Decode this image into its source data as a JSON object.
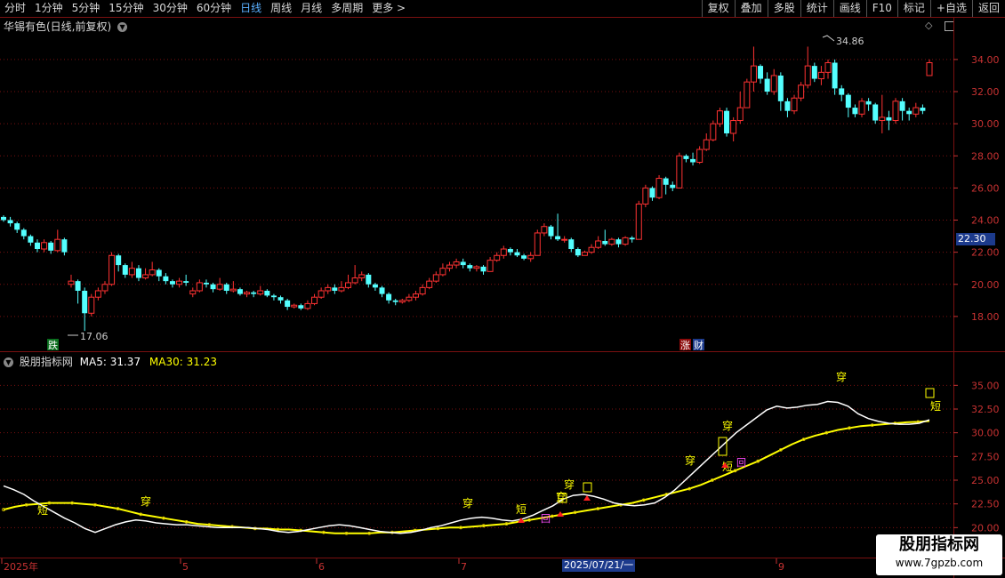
{
  "toolbar": {
    "left_items": [
      {
        "label": "分时",
        "active": false
      },
      {
        "label": "1分钟",
        "active": false
      },
      {
        "label": "5分钟",
        "active": false
      },
      {
        "label": "15分钟",
        "active": false
      },
      {
        "label": "30分钟",
        "active": false
      },
      {
        "label": "60分钟",
        "active": false
      },
      {
        "label": "日线",
        "active": true
      },
      {
        "label": "周线",
        "active": false
      },
      {
        "label": "月线",
        "active": false
      },
      {
        "label": "多周期",
        "active": false
      },
      {
        "label": "更多 >",
        "active": false
      }
    ],
    "right_items": [
      "复权",
      "叠加",
      "多股",
      "统计",
      "画线",
      "F10",
      "标记",
      "+自选",
      "返回"
    ]
  },
  "stock": {
    "title": "华锡有色(日线,前复权)",
    "current_price_tag": "22.30",
    "high_label": "34.86",
    "low_label": "17.06",
    "marker_die": "跌",
    "marker_zhang": "涨",
    "marker_cai": "财"
  },
  "indicator": {
    "name": "股朋指标网",
    "ma5_label": "MA5: 31.37",
    "ma30_label": "MA30: 31.23",
    "ma5_color": "#ffffff",
    "ma30_color": "#ffff00",
    "signal_chuan": "穿",
    "signal_duan": "短",
    "signal_hui": "回"
  },
  "axis": {
    "price_ticks": [
      "34.00",
      "32.00",
      "30.00",
      "28.00",
      "26.00",
      "24.00",
      "22.00",
      "20.00",
      "18.00"
    ],
    "indicator_ticks": [
      "35.00",
      "32.50",
      "30.00",
      "27.50",
      "25.00",
      "22.50",
      "20.00"
    ],
    "x_labels": [
      "2025年",
      "5",
      "6",
      "7",
      "9"
    ],
    "date_tag": "2025/07/21/一"
  },
  "colors": {
    "up": "#ff3232",
    "down": "#54ffff",
    "grid": "#7a1010",
    "axis_text": "#c83232"
  },
  "watermark": {
    "line1": "股朋指标网",
    "line2": "www.7gpzb.com"
  },
  "chart_data": {
    "type": "candlestick",
    "y_range": [
      16.0,
      35.6
    ],
    "candles": [
      [
        24.2,
        24.0,
        24.3,
        23.9
      ],
      [
        24.0,
        23.8,
        24.2,
        23.6
      ],
      [
        23.8,
        23.4,
        23.9,
        23.2
      ],
      [
        23.4,
        23.0,
        23.5,
        22.8
      ],
      [
        23.0,
        22.6,
        23.1,
        22.4
      ],
      [
        22.6,
        22.2,
        22.8,
        22.0
      ],
      [
        22.2,
        22.6,
        22.8,
        22.0
      ],
      [
        22.6,
        22.1,
        22.7,
        21.9
      ],
      [
        22.1,
        22.8,
        23.4,
        22.0
      ],
      [
        22.8,
        22.0,
        22.9,
        21.8
      ],
      [
        20.0,
        20.2,
        20.6,
        19.8
      ],
      [
        20.2,
        19.6,
        20.3,
        18.8
      ],
      [
        19.6,
        18.2,
        19.8,
        17.1
      ],
      [
        18.2,
        19.2,
        19.4,
        18.0
      ],
      [
        19.2,
        19.6,
        19.8,
        19.0
      ],
      [
        19.6,
        20.0,
        20.2,
        19.4
      ],
      [
        20.0,
        21.8,
        22.0,
        19.9
      ],
      [
        21.8,
        21.2,
        21.9,
        20.8
      ],
      [
        21.2,
        20.6,
        21.3,
        20.4
      ],
      [
        20.6,
        21.0,
        21.4,
        20.4
      ],
      [
        21.0,
        20.4,
        21.2,
        20.2
      ],
      [
        20.4,
        20.6,
        21.0,
        20.3
      ],
      [
        20.6,
        20.9,
        21.4,
        20.5
      ],
      [
        20.9,
        20.5,
        21.0,
        20.2
      ],
      [
        20.5,
        20.2,
        20.7,
        20.0
      ],
      [
        20.2,
        20.0,
        20.3,
        19.8
      ],
      [
        20.0,
        20.2,
        20.4,
        19.8
      ],
      [
        20.2,
        20.1,
        20.6,
        19.9
      ],
      [
        19.4,
        19.6,
        19.8,
        19.2
      ],
      [
        19.6,
        20.1,
        20.3,
        19.5
      ],
      [
        20.1,
        20.0,
        20.3,
        19.8
      ],
      [
        20.0,
        19.7,
        20.1,
        19.5
      ],
      [
        19.7,
        20.0,
        20.4,
        19.6
      ],
      [
        20.0,
        19.6,
        20.1,
        19.4
      ],
      [
        19.6,
        19.7,
        20.2,
        19.5
      ],
      [
        19.7,
        19.4,
        19.8,
        19.3
      ],
      [
        19.4,
        19.5,
        19.6,
        19.2
      ],
      [
        19.5,
        19.4,
        19.6,
        19.2
      ],
      [
        19.4,
        19.6,
        19.9,
        19.3
      ],
      [
        19.6,
        19.3,
        19.7,
        19.2
      ],
      [
        19.3,
        19.2,
        19.4,
        19.0
      ],
      [
        19.2,
        19.0,
        19.3,
        18.8
      ],
      [
        19.0,
        18.6,
        19.1,
        18.4
      ],
      [
        18.6,
        18.7,
        18.8,
        18.5
      ],
      [
        18.7,
        18.5,
        18.8,
        18.4
      ],
      [
        18.5,
        18.8,
        19.0,
        18.4
      ],
      [
        18.8,
        19.2,
        19.4,
        18.7
      ],
      [
        19.2,
        19.6,
        19.8,
        19.1
      ],
      [
        19.6,
        19.8,
        20.0,
        19.4
      ],
      [
        19.8,
        19.6,
        20.0,
        19.4
      ],
      [
        19.6,
        19.8,
        20.2,
        19.5
      ],
      [
        19.8,
        20.1,
        20.6,
        19.7
      ],
      [
        20.1,
        20.4,
        21.2,
        20.0
      ],
      [
        20.4,
        20.6,
        20.8,
        20.2
      ],
      [
        20.6,
        20.0,
        20.7,
        19.8
      ],
      [
        20.0,
        19.8,
        20.1,
        19.6
      ],
      [
        19.8,
        19.4,
        19.9,
        19.2
      ],
      [
        19.4,
        19.0,
        19.5,
        18.8
      ],
      [
        19.0,
        18.9,
        19.1,
        18.7
      ],
      [
        18.9,
        19.0,
        19.1,
        18.8
      ],
      [
        19.0,
        19.2,
        19.4,
        18.9
      ],
      [
        19.2,
        19.4,
        19.6,
        19.0
      ],
      [
        19.4,
        19.8,
        20.0,
        19.3
      ],
      [
        19.8,
        20.2,
        20.4,
        19.7
      ],
      [
        20.2,
        20.6,
        20.8,
        20.1
      ],
      [
        20.6,
        21.0,
        21.3,
        20.5
      ],
      [
        21.0,
        21.2,
        21.4,
        20.8
      ],
      [
        21.2,
        21.4,
        21.6,
        21.0
      ],
      [
        21.4,
        21.2,
        21.6,
        21.0
      ],
      [
        21.2,
        21.0,
        21.3,
        20.8
      ],
      [
        21.0,
        21.1,
        21.2,
        20.8
      ],
      [
        21.1,
        20.8,
        21.2,
        20.6
      ],
      [
        20.8,
        21.5,
        21.7,
        20.8
      ],
      [
        21.5,
        21.8,
        22.0,
        21.4
      ],
      [
        21.8,
        22.2,
        22.4,
        21.6
      ],
      [
        22.2,
        22.0,
        22.3,
        21.8
      ],
      [
        22.0,
        21.8,
        22.2,
        21.7
      ],
      [
        21.8,
        21.6,
        21.9,
        21.5
      ],
      [
        21.6,
        21.8,
        22.0,
        21.4
      ],
      [
        21.8,
        23.2,
        23.4,
        21.8
      ],
      [
        23.2,
        23.6,
        23.8,
        23.0
      ],
      [
        23.6,
        23.0,
        23.7,
        22.8
      ],
      [
        23.0,
        22.8,
        24.4,
        22.7
      ],
      [
        22.8,
        22.8,
        23.0,
        22.6
      ],
      [
        22.8,
        22.2,
        22.9,
        22.0
      ],
      [
        22.2,
        21.8,
        22.3,
        21.7
      ],
      [
        21.8,
        22.0,
        22.1,
        21.8
      ],
      [
        22.0,
        22.3,
        22.5,
        21.9
      ],
      [
        22.3,
        22.7,
        23.0,
        22.2
      ],
      [
        22.7,
        22.5,
        23.4,
        22.4
      ],
      [
        22.5,
        22.8,
        22.9,
        22.4
      ],
      [
        22.8,
        22.5,
        22.9,
        22.3
      ],
      [
        22.5,
        22.9,
        23.0,
        22.4
      ],
      [
        22.9,
        22.8,
        23.0,
        22.6
      ],
      [
        22.8,
        25.0,
        25.2,
        22.8
      ],
      [
        25.0,
        26.0,
        26.2,
        24.8
      ],
      [
        26.0,
        25.4,
        26.1,
        25.2
      ],
      [
        25.4,
        26.6,
        26.8,
        25.3
      ],
      [
        26.6,
        26.2,
        26.7,
        25.6
      ],
      [
        26.2,
        26.0,
        26.4,
        25.8
      ],
      [
        26.0,
        28.0,
        28.2,
        26.0
      ],
      [
        28.0,
        27.8,
        28.1,
        27.6
      ],
      [
        27.8,
        27.6,
        28.2,
        27.4
      ],
      [
        27.6,
        28.4,
        28.6,
        27.5
      ],
      [
        28.4,
        29.0,
        29.4,
        28.3
      ],
      [
        29.0,
        30.0,
        30.2,
        28.9
      ],
      [
        30.0,
        30.8,
        31.0,
        29.8
      ],
      [
        30.8,
        29.4,
        31.0,
        29.2
      ],
      [
        29.4,
        30.2,
        30.4,
        28.9
      ],
      [
        30.2,
        31.0,
        32.0,
        30.0
      ],
      [
        31.0,
        32.6,
        32.8,
        31.0
      ],
      [
        32.6,
        33.6,
        34.8,
        32.0
      ],
      [
        33.6,
        32.8,
        33.7,
        32.5
      ],
      [
        32.8,
        32.0,
        33.2,
        31.8
      ],
      [
        32.0,
        33.0,
        33.4,
        31.8
      ],
      [
        33.0,
        31.4,
        33.2,
        30.8
      ],
      [
        31.4,
        30.8,
        31.6,
        30.4
      ],
      [
        30.8,
        31.6,
        31.8,
        30.6
      ],
      [
        31.6,
        32.4,
        32.6,
        31.4
      ],
      [
        32.4,
        33.6,
        34.8,
        32.2
      ],
      [
        33.6,
        32.8,
        33.8,
        32.6
      ],
      [
        32.8,
        33.2,
        33.6,
        32.4
      ],
      [
        33.2,
        33.8,
        34.0,
        32.8
      ],
      [
        33.8,
        32.2,
        34.0,
        31.8
      ],
      [
        32.2,
        31.8,
        32.4,
        31.4
      ],
      [
        31.8,
        31.0,
        31.9,
        30.4
      ],
      [
        31.0,
        30.6,
        31.2,
        30.4
      ],
      [
        30.6,
        31.4,
        31.6,
        30.4
      ],
      [
        31.4,
        31.2,
        31.6,
        30.8
      ],
      [
        31.2,
        30.2,
        31.3,
        30.0
      ],
      [
        30.2,
        30.4,
        31.8,
        29.4
      ],
      [
        30.4,
        30.2,
        30.8,
        29.6
      ],
      [
        30.2,
        31.4,
        31.6,
        30.0
      ],
      [
        31.4,
        30.8,
        31.6,
        30.2
      ],
      [
        30.8,
        30.6,
        31.0,
        30.2
      ],
      [
        30.6,
        31.0,
        31.3,
        30.4
      ],
      [
        31.0,
        30.8,
        31.2,
        30.6
      ],
      [
        33.0,
        33.8,
        34.0,
        33.0
      ]
    ],
    "indicator_range": [
      17.5,
      37.0
    ],
    "ma5": [
      24.4,
      24.0,
      23.5,
      22.8,
      22.2,
      21.6,
      21.0,
      20.5,
      19.9,
      19.5,
      19.9,
      20.3,
      20.6,
      20.8,
      20.7,
      20.5,
      20.4,
      20.3,
      20.3,
      20.2,
      20.1,
      20.0,
      20.0,
      20.0,
      20.0,
      19.9,
      19.8,
      19.6,
      19.5,
      19.6,
      19.8,
      20.0,
      20.2,
      20.3,
      20.2,
      20.0,
      19.8,
      19.6,
      19.5,
      19.4,
      19.5,
      19.7,
      20.0,
      20.2,
      20.5,
      20.8,
      21.0,
      21.1,
      21.0,
      20.8,
      20.7,
      20.9,
      21.3,
      21.8,
      22.3,
      23.0,
      23.4,
      23.5,
      23.3,
      23.0,
      22.6,
      22.4,
      22.3,
      22.4,
      22.6,
      23.2,
      24.0,
      25.0,
      26.0,
      27.0,
      28.0,
      29.0,
      30.0,
      30.8,
      31.6,
      32.4,
      32.8,
      32.6,
      32.7,
      32.9,
      33.0,
      33.3,
      33.2,
      32.8,
      32.0,
      31.5,
      31.2,
      31.0,
      30.9,
      30.9,
      31.0,
      31.37
    ],
    "ma30": [
      21.9,
      22.2,
      22.4,
      22.5,
      22.6,
      22.6,
      22.6,
      22.5,
      22.4,
      22.2,
      22.0,
      21.7,
      21.4,
      21.2,
      21.0,
      20.8,
      20.6,
      20.4,
      20.3,
      20.2,
      20.1,
      20.0,
      19.9,
      19.9,
      19.8,
      19.8,
      19.7,
      19.6,
      19.5,
      19.4,
      19.4,
      19.4,
      19.4,
      19.5,
      19.5,
      19.6,
      19.7,
      19.8,
      19.9,
      20.0,
      20.0,
      20.1,
      20.2,
      20.3,
      20.4,
      20.6,
      20.8,
      21.0,
      21.2,
      21.4,
      21.6,
      21.8,
      22.0,
      22.2,
      22.4,
      22.6,
      22.9,
      23.2,
      23.5,
      23.8,
      24.1,
      24.5,
      25.0,
      25.5,
      26.0,
      26.5,
      27.0,
      27.6,
      28.2,
      28.8,
      29.3,
      29.7,
      30.0,
      30.3,
      30.5,
      30.7,
      30.8,
      30.9,
      31.0,
      31.1,
      31.15,
      31.23
    ]
  }
}
